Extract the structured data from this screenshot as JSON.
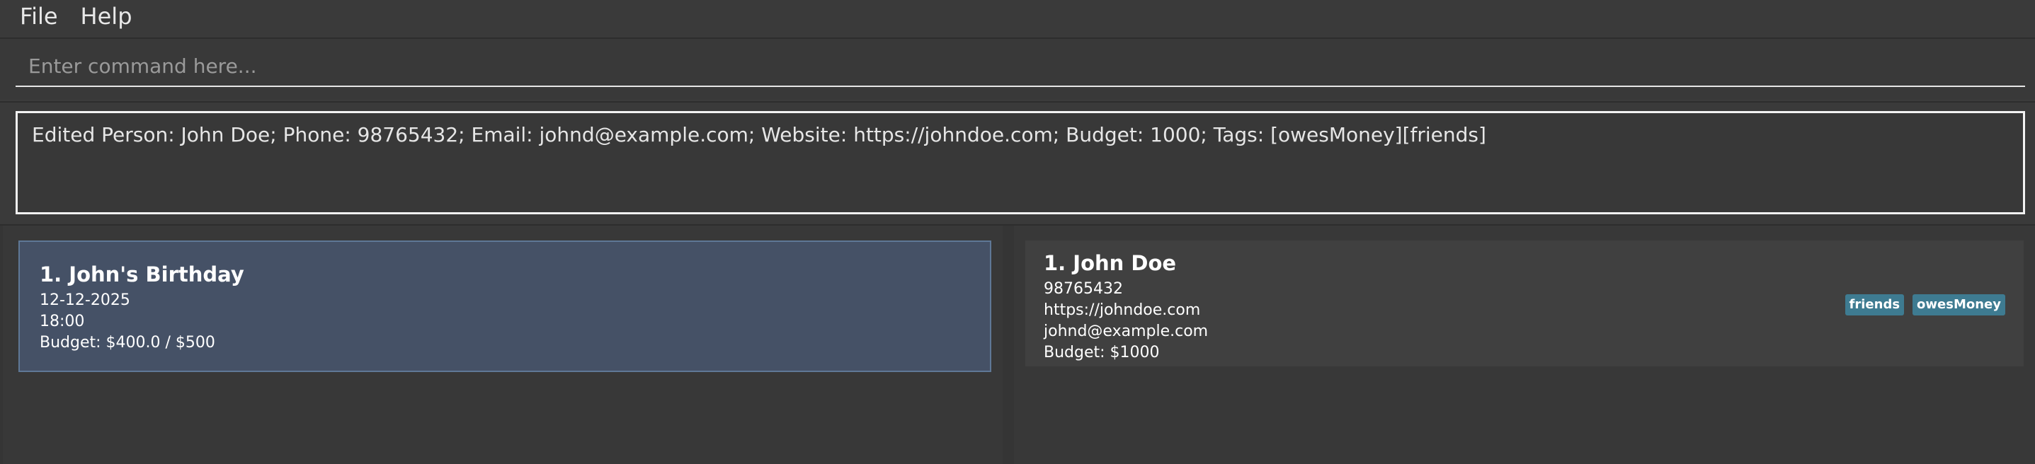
{
  "menu": {
    "file": "File",
    "help": "Help"
  },
  "command": {
    "placeholder": "Enter command here..."
  },
  "result": {
    "text": "Edited Person: John Doe; Phone: 98765432; Email: johnd@example.com; Website: https://johndoe.com; Budget: 1000; Tags: [owesMoney][friends]"
  },
  "events": [
    {
      "title": "1. John's Birthday",
      "date": "12-12-2025",
      "time": "18:00",
      "budget": "Budget: $400.0 / $500"
    }
  ],
  "persons": [
    {
      "name": "1. John Doe",
      "phone": "98765432",
      "website": "https://johndoe.com",
      "email": "johnd@example.com",
      "budget": "Budget: $1000",
      "tags": [
        "friends",
        "owesMoney"
      ]
    }
  ],
  "colors": {
    "selected_card": "#455166",
    "tag": "#3e7b91",
    "background": "#3c3c3c"
  }
}
